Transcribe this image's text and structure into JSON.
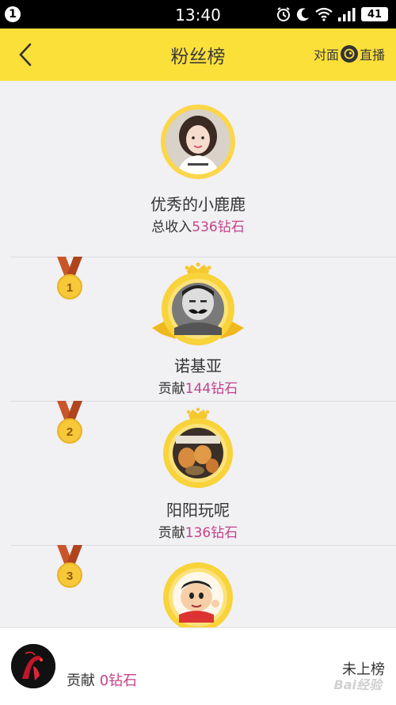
{
  "status_bar": {
    "notification_count": "1",
    "time": "13:40",
    "battery": "41"
  },
  "header": {
    "title": "粉丝榜",
    "live_left": "对面",
    "live_right": "直播"
  },
  "host": {
    "name": "优秀的小鹿鹿",
    "income_prefix": "总收入",
    "income_amount": "536钻石"
  },
  "ranks": [
    {
      "rank": "1",
      "name": "诺基亚",
      "prefix": "贡献",
      "amount": "144钻石"
    },
    {
      "rank": "2",
      "name": "阳阳玩呢",
      "prefix": "贡献",
      "amount": "136钻石"
    },
    {
      "rank": "3",
      "name": "",
      "prefix": "",
      "amount": ""
    }
  ],
  "me": {
    "prefix": "贡献",
    "amount": "0钻石",
    "rank_status": "未上榜"
  },
  "watermark": "Bai经验",
  "colors": {
    "accent": "#fce03a",
    "amount": "#c2448a",
    "medal_ribbon": "#c8562a",
    "medal_gold": "#f6c83a"
  },
  "icons": [
    "back-arrow-icon",
    "alarm-icon",
    "moon-icon",
    "wifi-icon",
    "signal-icon",
    "live-logo-icon",
    "medal-icon",
    "crown-icon"
  ]
}
